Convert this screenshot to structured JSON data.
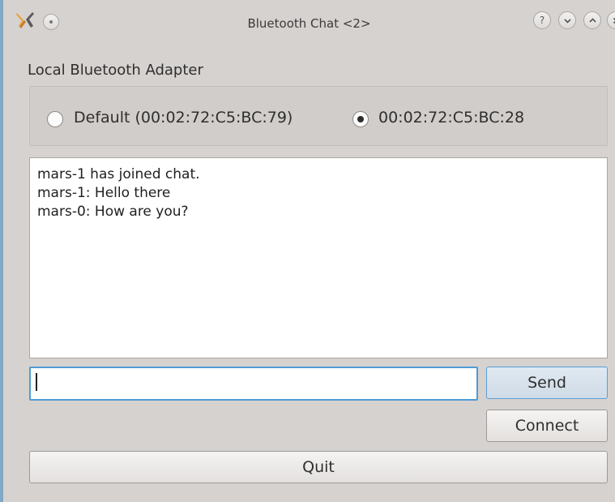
{
  "window": {
    "title": "Bluetooth Chat <2>",
    "controls": {
      "help": "?",
      "minimize": "minimize",
      "maximize": "maximize",
      "close": "close"
    },
    "icons": {
      "app": "bluetooth-chat-app-icon",
      "menu": "window-menu-icon"
    }
  },
  "adapter": {
    "label": "Local Bluetooth Adapter",
    "options": [
      {
        "label": "Default (00:02:72:C5:BC:79)",
        "checked": false
      },
      {
        "label": "00:02:72:C5:BC:28",
        "checked": true
      }
    ]
  },
  "chat": {
    "lines": [
      "mars-1 has joined chat.",
      "mars-1: Hello there",
      "mars-0: How are you?"
    ]
  },
  "input": {
    "value": "",
    "placeholder": ""
  },
  "buttons": {
    "send": "Send",
    "connect": "Connect",
    "quit": "Quit"
  },
  "colors": {
    "focus_border": "#4f9bd4",
    "window_bg": "#d6d2d0"
  }
}
